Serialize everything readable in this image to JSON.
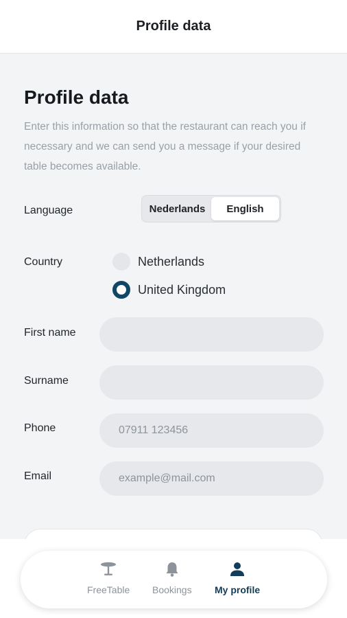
{
  "header": {
    "title": "Profile data"
  },
  "main": {
    "title": "Profile data",
    "description": "Enter this information so that the restaurant can reach you if necessary and we can send you a message if your desired table becomes available.",
    "language": {
      "label": "Language",
      "options": [
        "Nederlands",
        "English"
      ],
      "selected": "English"
    },
    "country": {
      "label": "Country",
      "options": [
        {
          "label": "Netherlands",
          "checked": false
        },
        {
          "label": "United Kingdom",
          "checked": true
        }
      ]
    },
    "fields": {
      "first_name": {
        "label": "First name",
        "value": "",
        "placeholder": ""
      },
      "surname": {
        "label": "Surname",
        "value": "",
        "placeholder": ""
      },
      "phone": {
        "label": "Phone",
        "value": "",
        "placeholder": "07911 123456"
      },
      "email": {
        "label": "Email",
        "value": "",
        "placeholder": "example@mail.com"
      }
    }
  },
  "tabbar": {
    "items": [
      {
        "label": "FreeTable",
        "icon": "table-icon",
        "active": false
      },
      {
        "label": "Bookings",
        "icon": "bell-icon",
        "active": false
      },
      {
        "label": "My profile",
        "icon": "person-icon",
        "active": true
      }
    ]
  },
  "colors": {
    "accent": "#114766",
    "background": "#f2f4f6",
    "field": "#e6e8eb",
    "muted_text": "#9aa0a7"
  }
}
